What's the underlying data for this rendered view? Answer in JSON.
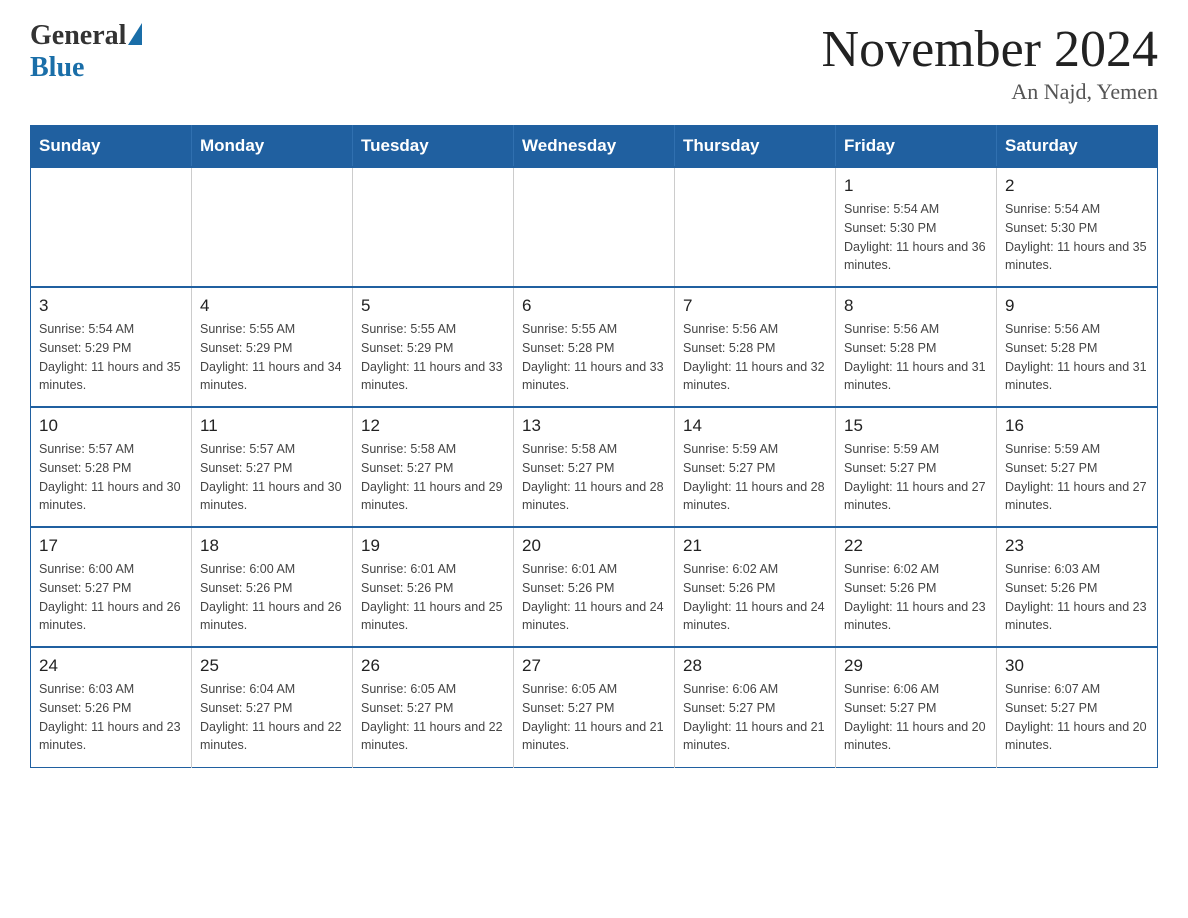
{
  "logo": {
    "general": "General",
    "blue": "Blue"
  },
  "title": "November 2024",
  "subtitle": "An Najd, Yemen",
  "days_header": [
    "Sunday",
    "Monday",
    "Tuesday",
    "Wednesday",
    "Thursday",
    "Friday",
    "Saturday"
  ],
  "weeks": [
    [
      {
        "day": "",
        "info": ""
      },
      {
        "day": "",
        "info": ""
      },
      {
        "day": "",
        "info": ""
      },
      {
        "day": "",
        "info": ""
      },
      {
        "day": "",
        "info": ""
      },
      {
        "day": "1",
        "info": "Sunrise: 5:54 AM\nSunset: 5:30 PM\nDaylight: 11 hours and 36 minutes."
      },
      {
        "day": "2",
        "info": "Sunrise: 5:54 AM\nSunset: 5:30 PM\nDaylight: 11 hours and 35 minutes."
      }
    ],
    [
      {
        "day": "3",
        "info": "Sunrise: 5:54 AM\nSunset: 5:29 PM\nDaylight: 11 hours and 35 minutes."
      },
      {
        "day": "4",
        "info": "Sunrise: 5:55 AM\nSunset: 5:29 PM\nDaylight: 11 hours and 34 minutes."
      },
      {
        "day": "5",
        "info": "Sunrise: 5:55 AM\nSunset: 5:29 PM\nDaylight: 11 hours and 33 minutes."
      },
      {
        "day": "6",
        "info": "Sunrise: 5:55 AM\nSunset: 5:28 PM\nDaylight: 11 hours and 33 minutes."
      },
      {
        "day": "7",
        "info": "Sunrise: 5:56 AM\nSunset: 5:28 PM\nDaylight: 11 hours and 32 minutes."
      },
      {
        "day": "8",
        "info": "Sunrise: 5:56 AM\nSunset: 5:28 PM\nDaylight: 11 hours and 31 minutes."
      },
      {
        "day": "9",
        "info": "Sunrise: 5:56 AM\nSunset: 5:28 PM\nDaylight: 11 hours and 31 minutes."
      }
    ],
    [
      {
        "day": "10",
        "info": "Sunrise: 5:57 AM\nSunset: 5:28 PM\nDaylight: 11 hours and 30 minutes."
      },
      {
        "day": "11",
        "info": "Sunrise: 5:57 AM\nSunset: 5:27 PM\nDaylight: 11 hours and 30 minutes."
      },
      {
        "day": "12",
        "info": "Sunrise: 5:58 AM\nSunset: 5:27 PM\nDaylight: 11 hours and 29 minutes."
      },
      {
        "day": "13",
        "info": "Sunrise: 5:58 AM\nSunset: 5:27 PM\nDaylight: 11 hours and 28 minutes."
      },
      {
        "day": "14",
        "info": "Sunrise: 5:59 AM\nSunset: 5:27 PM\nDaylight: 11 hours and 28 minutes."
      },
      {
        "day": "15",
        "info": "Sunrise: 5:59 AM\nSunset: 5:27 PM\nDaylight: 11 hours and 27 minutes."
      },
      {
        "day": "16",
        "info": "Sunrise: 5:59 AM\nSunset: 5:27 PM\nDaylight: 11 hours and 27 minutes."
      }
    ],
    [
      {
        "day": "17",
        "info": "Sunrise: 6:00 AM\nSunset: 5:27 PM\nDaylight: 11 hours and 26 minutes."
      },
      {
        "day": "18",
        "info": "Sunrise: 6:00 AM\nSunset: 5:26 PM\nDaylight: 11 hours and 26 minutes."
      },
      {
        "day": "19",
        "info": "Sunrise: 6:01 AM\nSunset: 5:26 PM\nDaylight: 11 hours and 25 minutes."
      },
      {
        "day": "20",
        "info": "Sunrise: 6:01 AM\nSunset: 5:26 PM\nDaylight: 11 hours and 24 minutes."
      },
      {
        "day": "21",
        "info": "Sunrise: 6:02 AM\nSunset: 5:26 PM\nDaylight: 11 hours and 24 minutes."
      },
      {
        "day": "22",
        "info": "Sunrise: 6:02 AM\nSunset: 5:26 PM\nDaylight: 11 hours and 23 minutes."
      },
      {
        "day": "23",
        "info": "Sunrise: 6:03 AM\nSunset: 5:26 PM\nDaylight: 11 hours and 23 minutes."
      }
    ],
    [
      {
        "day": "24",
        "info": "Sunrise: 6:03 AM\nSunset: 5:26 PM\nDaylight: 11 hours and 23 minutes."
      },
      {
        "day": "25",
        "info": "Sunrise: 6:04 AM\nSunset: 5:27 PM\nDaylight: 11 hours and 22 minutes."
      },
      {
        "day": "26",
        "info": "Sunrise: 6:05 AM\nSunset: 5:27 PM\nDaylight: 11 hours and 22 minutes."
      },
      {
        "day": "27",
        "info": "Sunrise: 6:05 AM\nSunset: 5:27 PM\nDaylight: 11 hours and 21 minutes."
      },
      {
        "day": "28",
        "info": "Sunrise: 6:06 AM\nSunset: 5:27 PM\nDaylight: 11 hours and 21 minutes."
      },
      {
        "day": "29",
        "info": "Sunrise: 6:06 AM\nSunset: 5:27 PM\nDaylight: 11 hours and 20 minutes."
      },
      {
        "day": "30",
        "info": "Sunrise: 6:07 AM\nSunset: 5:27 PM\nDaylight: 11 hours and 20 minutes."
      }
    ]
  ]
}
